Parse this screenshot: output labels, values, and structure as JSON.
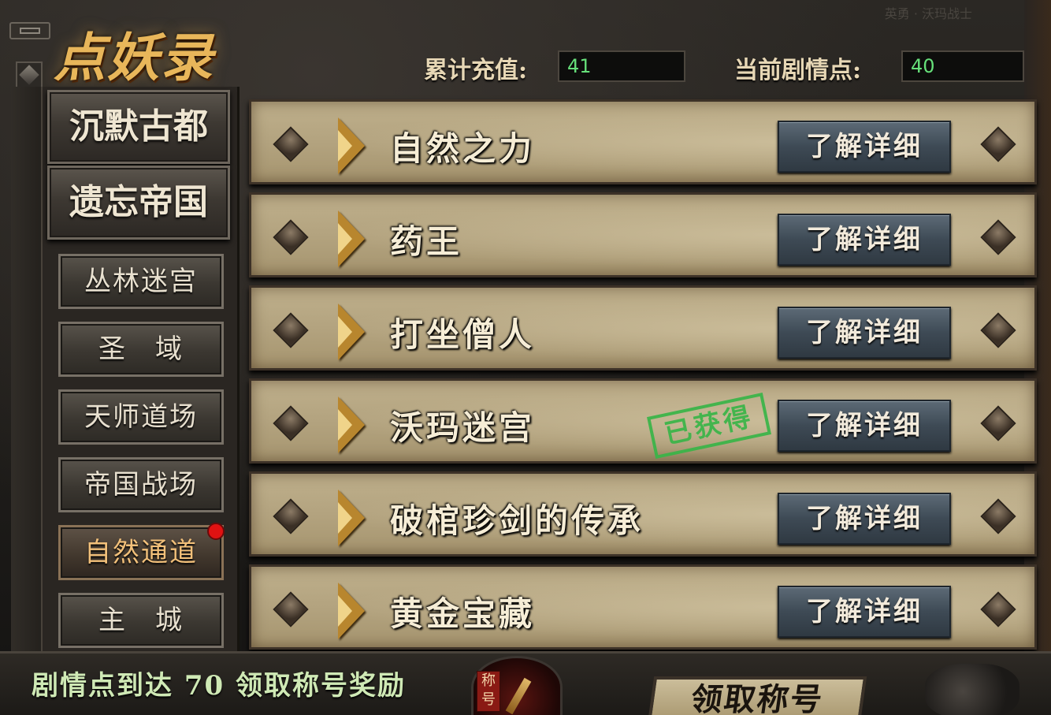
{
  "header": {
    "logo": "点妖录",
    "map_hint": "英勇 · 沃玛战士",
    "recharge_label": "累计充值:",
    "recharge_value": "41",
    "story_label": "当前剧情点:",
    "story_value": "40"
  },
  "sidebar": {
    "big_tabs": [
      {
        "label": "沉默古都"
      },
      {
        "label": "遗忘帝国"
      }
    ],
    "small_tabs": [
      {
        "label": "丛林迷宫",
        "active": false
      },
      {
        "label": "圣　域",
        "active": false
      },
      {
        "label": "天师道场",
        "active": false
      },
      {
        "label": "帝国战场",
        "active": false
      },
      {
        "label": "自然通道",
        "active": true
      },
      {
        "label": "主　城",
        "active": false
      }
    ]
  },
  "list": {
    "detail_label": "了解详细",
    "obtained_stamp": "已获得",
    "items": [
      {
        "title": "自然之力",
        "obtained": false
      },
      {
        "title": "药王",
        "obtained": false
      },
      {
        "title": "打坐僧人",
        "obtained": false
      },
      {
        "title": "沃玛迷宫",
        "obtained": true
      },
      {
        "title": "破棺珍剑的传承",
        "obtained": false
      },
      {
        "title": "黄金宝藏",
        "obtained": false
      }
    ]
  },
  "footer": {
    "reward_text": "剧情点到达 70 领取称号奖励",
    "emblem_tag": "称号",
    "claim_button": "领取称号"
  },
  "colors": {
    "value_green": "#66e07a",
    "stamp_green": "#39b548",
    "logo_gold": "#e8b65a",
    "notify_red": "#e01212"
  }
}
